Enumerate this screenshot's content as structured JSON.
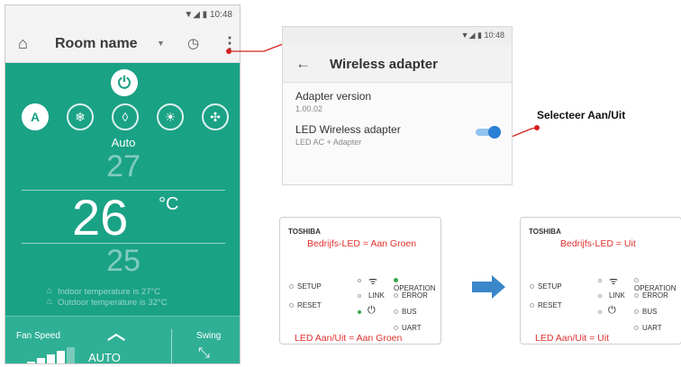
{
  "phone1": {
    "status_time": "10:48",
    "room_name": "Room name",
    "mode_label": "Auto",
    "setpoint_above": "27",
    "current_setpoint": "26",
    "unit": "°C",
    "setpoint_below": "25",
    "indoor_text": "Indoor temperature is 27°C",
    "outdoor_text": "Outdoor temperature is 32°C",
    "fan_speed_label": "Fan Speed",
    "fan_speed_value": "AUTO",
    "swing_label": "Swing",
    "modes": [
      "A",
      "❄",
      "◊",
      "☀",
      "✣"
    ],
    "active_mode_index": 0,
    "fan_level": 4,
    "fan_levels_total": 5
  },
  "phone2": {
    "status_time": "10:48",
    "title": "Wireless adapter",
    "adapter_version_label": "Adapter version",
    "adapter_version_value": "1.00.02",
    "led_label": "LED Wireless adapter",
    "led_sub": "LED AC + Adapter",
    "toggle_on": true
  },
  "callout": "Selecteer Aan/Uit",
  "panel_left": {
    "brand": "TOSHIBA",
    "top_label": "Bedrijfs-LED = Aan Groen",
    "bottom_label": "LED Aan/Uit  = Aan Groen",
    "leds": [
      "SETUP",
      "RESET",
      "LINK",
      "OPERATION",
      "ERROR",
      "BUS",
      "UART"
    ]
  },
  "panel_right": {
    "brand": "TOSHIBA",
    "top_label": "Bedrijfs-LED = Uit",
    "bottom_label": "LED Aan/Uit = Uit",
    "leds": [
      "SETUP",
      "RESET",
      "LINK",
      "OPERATION",
      "ERROR",
      "BUS",
      "UART"
    ]
  },
  "colors": {
    "teal": "#1aa285",
    "callout_red": "#d6201f",
    "led_green": "#3aa64a",
    "arrow_blue": "#3a87c9"
  }
}
